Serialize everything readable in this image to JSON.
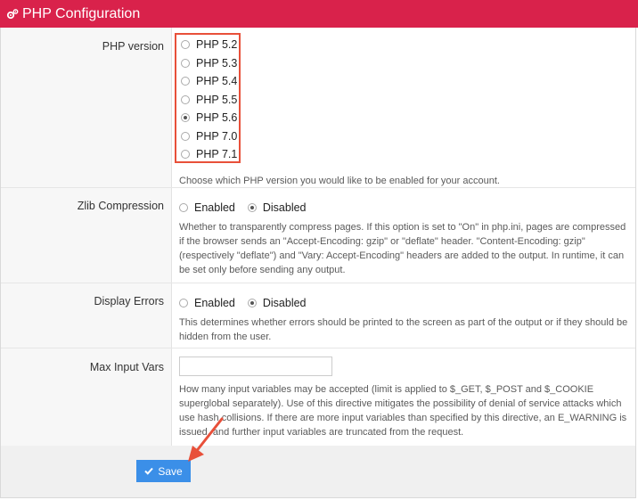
{
  "header": {
    "title": "PHP Configuration",
    "icon": "gears-icon"
  },
  "php_version": {
    "label": "PHP version",
    "options": [
      "PHP 5.2",
      "PHP 5.3",
      "PHP 5.4",
      "PHP 5.5",
      "PHP 5.6",
      "PHP 7.0",
      "PHP 7.1"
    ],
    "selected": "PHP 5.6",
    "help": "Choose which PHP version you would like to be enabled for your account."
  },
  "zlib": {
    "label": "Zlib Compression",
    "options": [
      "Enabled",
      "Disabled"
    ],
    "selected": "Disabled",
    "help": "Whether to transparently compress pages. If this option is set to \"On\" in php.ini, pages are compressed if the browser sends an \"Accept-Encoding: gzip\" or \"deflate\" header. \"Content-Encoding: gzip\" (respectively \"deflate\") and \"Vary: Accept-Encoding\" headers are added to the output. In runtime, it can be set only before sending any output."
  },
  "display_errors": {
    "label": "Display Errors",
    "options": [
      "Enabled",
      "Disabled"
    ],
    "selected": "Disabled",
    "help": "This determines whether errors should be printed to the screen as part of the output or if they should be hidden from the user."
  },
  "max_input_vars": {
    "label": "Max Input Vars",
    "value": "",
    "help": "How many input variables may be accepted (limit is applied to $_GET, $_POST and $_COOKIE superglobal separately). Use of this directive mitigates the possibility of denial of service attacks which use hash collisions. If there are more input variables than specified by this directive, an E_WARNING is issued, and further input variables are truncated from the request."
  },
  "footer": {
    "save_label": "Save"
  },
  "colors": {
    "header": "#d9224b",
    "highlight": "#e8503a",
    "button": "#3b8fe8"
  }
}
